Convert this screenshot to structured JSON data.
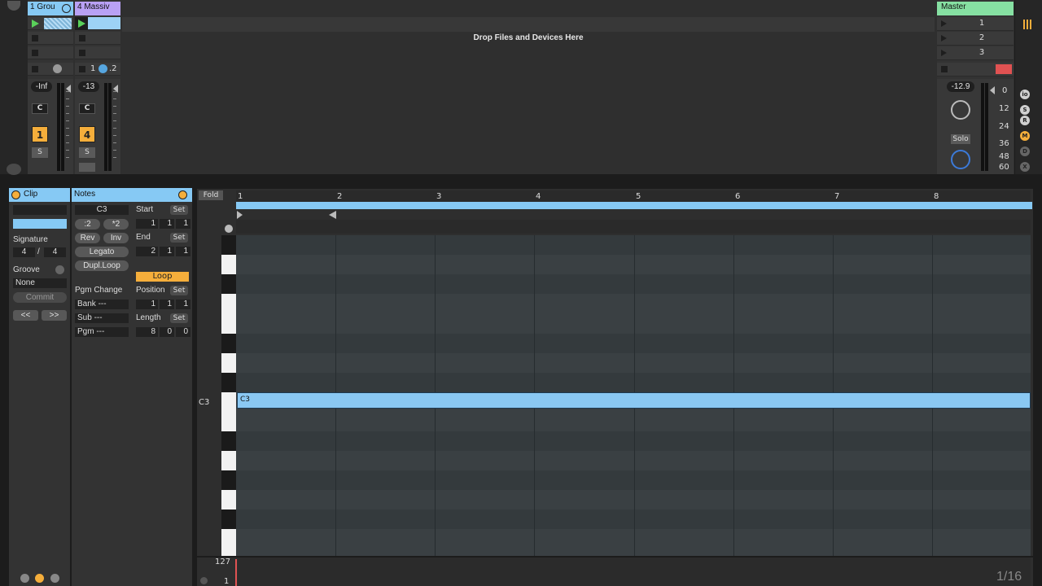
{
  "session": {
    "drop_text": "Drop Files and Devices Here",
    "tracks": [
      {
        "title": "1 Grou",
        "color": "#86c9f4",
        "volume": "-Inf",
        "pan": "C",
        "number": "1",
        "solo": "S"
      },
      {
        "title": "4 Massiv",
        "color": "#b9a1f5",
        "volume": "-13",
        "pan": "C",
        "number": "4",
        "solo": "S",
        "send_a": "1",
        "send_b": ".2"
      }
    ],
    "master": {
      "title": "Master",
      "scenes": [
        "1",
        "2",
        "3"
      ],
      "volume": "-12.9",
      "solo_label": "Solo",
      "db_scale": [
        "0",
        "12",
        "24",
        "36",
        "48",
        "60"
      ]
    }
  },
  "clip_panel": {
    "head": "Clip",
    "signature_label": "Signature",
    "sig_num": "4",
    "sig_sep": "/",
    "sig_den": "4",
    "groove_label": "Groove",
    "groove_value": "None",
    "commit": "Commit",
    "prev": "<<",
    "next": ">>"
  },
  "notes_panel": {
    "head": "Notes",
    "note_field": "C3",
    "half": ":2",
    "double": "*2",
    "rev": "Rev",
    "inv": "Inv",
    "legato": "Legato",
    "dupl": "Dupl.Loop",
    "start_label": "Start",
    "start_vals": [
      "1",
      "1",
      "1"
    ],
    "end_label": "End",
    "end_vals": [
      "2",
      "1",
      "1"
    ],
    "set": "Set",
    "loop": "Loop",
    "position_label": "Position",
    "position_vals": [
      "1",
      "1",
      "1"
    ],
    "length_label": "Length",
    "length_vals": [
      "8",
      "0",
      "0"
    ],
    "pgm_change": "Pgm Change",
    "bank": "Bank ---",
    "sub": "Sub ---",
    "pgm": "Pgm ---"
  },
  "piano_roll": {
    "fold": "Fold",
    "bars": [
      "1",
      "2",
      "3",
      "4",
      "5",
      "6",
      "7",
      "8"
    ],
    "key_label": "C3",
    "note_label": "C3"
  },
  "velocity": {
    "max": "127",
    "min": "1",
    "grid": "1/16"
  }
}
